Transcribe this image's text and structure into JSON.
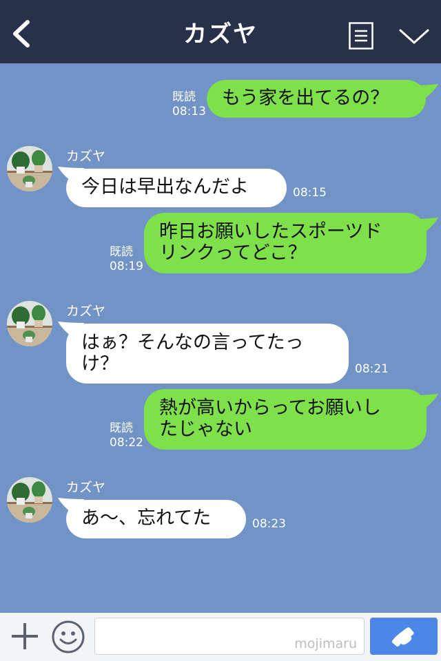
{
  "header": {
    "title": "カズヤ",
    "back_icon": "chevron-left-icon",
    "notes_icon": "notes-icon",
    "menu_icon": "chevron-down-icon"
  },
  "messages": [
    {
      "side": "sent",
      "lines": [
        "もう家を出てるの？"
      ],
      "read": "既読",
      "time": "08:13"
    },
    {
      "side": "recv",
      "sender": "カズヤ",
      "lines": [
        "今日は早出なんだよ"
      ],
      "time": "08:15"
    },
    {
      "side": "sent",
      "lines": [
        "昨日お願いしたスポーツド",
        "リンクってどこ？"
      ],
      "read": "既読",
      "time": "08:19"
    },
    {
      "side": "recv",
      "sender": "カズヤ",
      "lines": [
        "はぁ？そんなの言ってたっ",
        "け？"
      ],
      "time": "08:21"
    },
    {
      "side": "sent",
      "lines": [
        "熱が高いからってお願いし",
        "たじゃない"
      ],
      "read": "既読",
      "time": "08:22"
    },
    {
      "side": "recv",
      "sender": "カズヤ",
      "lines": [
        "あ〜、忘れてた"
      ],
      "time": "08:23"
    }
  ],
  "input": {
    "watermark": "mojimaru",
    "placeholder": ""
  },
  "colors": {
    "header_bg": "#273149",
    "chat_bg": "#7193c5",
    "sent_bubble": "#7ee04a",
    "recv_bubble": "#ffffff",
    "call_button": "#4c86e6"
  }
}
